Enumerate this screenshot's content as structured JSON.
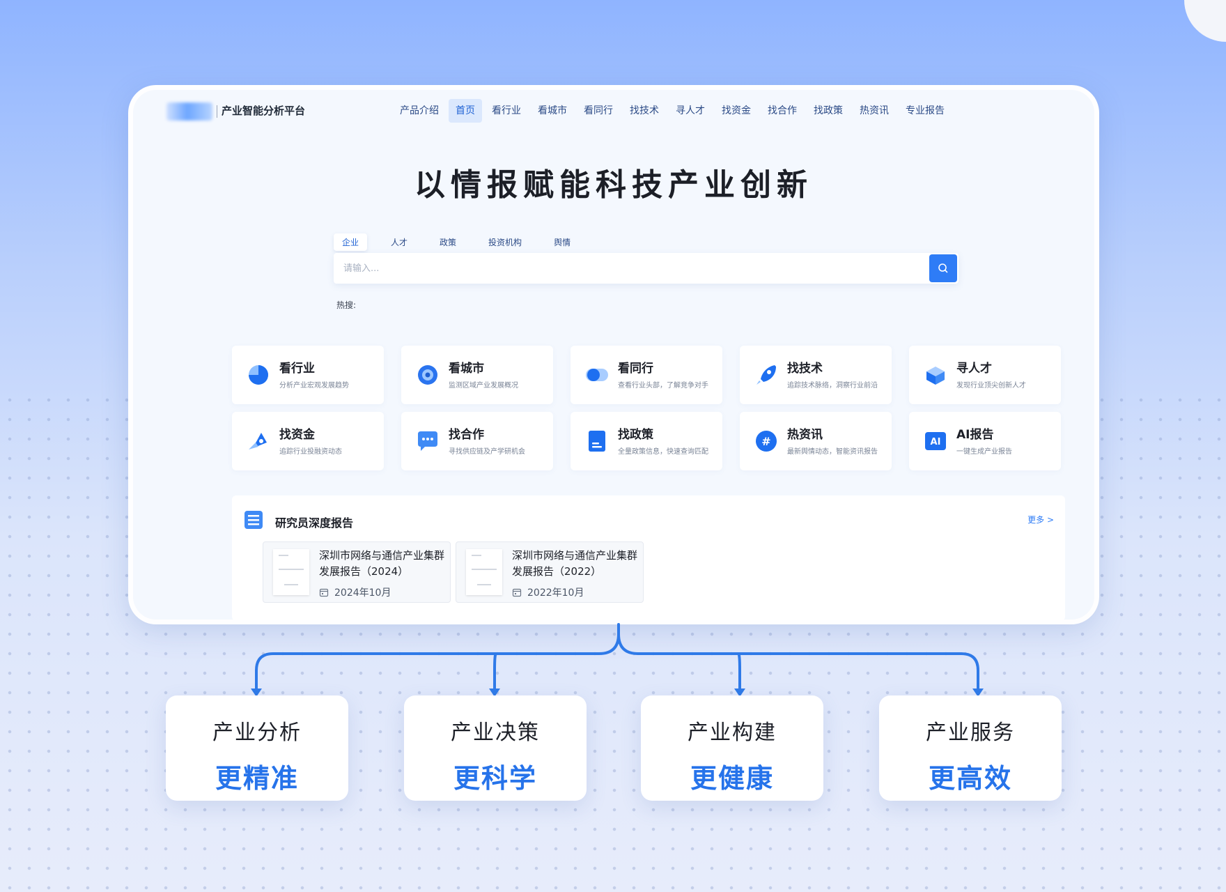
{
  "header": {
    "brand": "产业智能分析平台",
    "nav": [
      "产品介绍",
      "首页",
      "看行业",
      "看城市",
      "看同行",
      "找技术",
      "寻人才",
      "找资金",
      "找合作",
      "找政策",
      "热资讯",
      "专业报告"
    ],
    "active_nav": "首页"
  },
  "hero": {
    "title": "以情报赋能科技产业创新"
  },
  "search": {
    "tabs": [
      "企业",
      "人才",
      "政策",
      "投资机构",
      "舆情"
    ],
    "active_tab": "企业",
    "placeholder": "请输入...",
    "hot_label": "热搜:"
  },
  "modules": [
    {
      "title": "看行业",
      "desc": "分析产业宏观发展趋势",
      "icon": "pie-chart-icon"
    },
    {
      "title": "看城市",
      "desc": "监测区域产业发展概况",
      "icon": "city-target-icon"
    },
    {
      "title": "看同行",
      "desc": "查看行业头部，了解竞争对手",
      "icon": "peer-toggle-icon"
    },
    {
      "title": "找技术",
      "desc": "追踪技术脉络，洞察行业前沿",
      "icon": "rocket-icon"
    },
    {
      "title": "寻人才",
      "desc": "发现行业顶尖创新人才",
      "icon": "talent-cube-icon"
    },
    {
      "title": "找资金",
      "desc": "追踪行业投融资动态",
      "icon": "funding-icon"
    },
    {
      "title": "找合作",
      "desc": "寻找供应链及产学研机会",
      "icon": "chat-bubble-icon"
    },
    {
      "title": "找政策",
      "desc": "全量政策信息，快速查询匹配",
      "icon": "policy-document-icon"
    },
    {
      "title": "热资讯",
      "desc": "最新舆情动态，智能资讯报告",
      "icon": "hashtag-icon"
    },
    {
      "title": "AI报告",
      "desc": "一键生成产业报告",
      "icon": "ai-report-icon"
    }
  ],
  "reports": {
    "title": "研究员深度报告",
    "more": "更多 >",
    "items": [
      {
        "title": "深圳市网络与通信产业集群发展报告（2024）",
        "date": "2024年10月"
      },
      {
        "title": "深圳市网络与通信产业集群发展报告（2022）",
        "date": "2022年10月"
      }
    ]
  },
  "benefits": [
    {
      "top": "产业分析",
      "bottom": "更精准"
    },
    {
      "top": "产业决策",
      "bottom": "更科学"
    },
    {
      "top": "产业构建",
      "bottom": "更健康"
    },
    {
      "top": "产业服务",
      "bottom": "更高效"
    }
  ],
  "colors": {
    "accent": "#2e7cf6",
    "connector": "#2f7ae8",
    "benefit_text": "#2673ea"
  }
}
